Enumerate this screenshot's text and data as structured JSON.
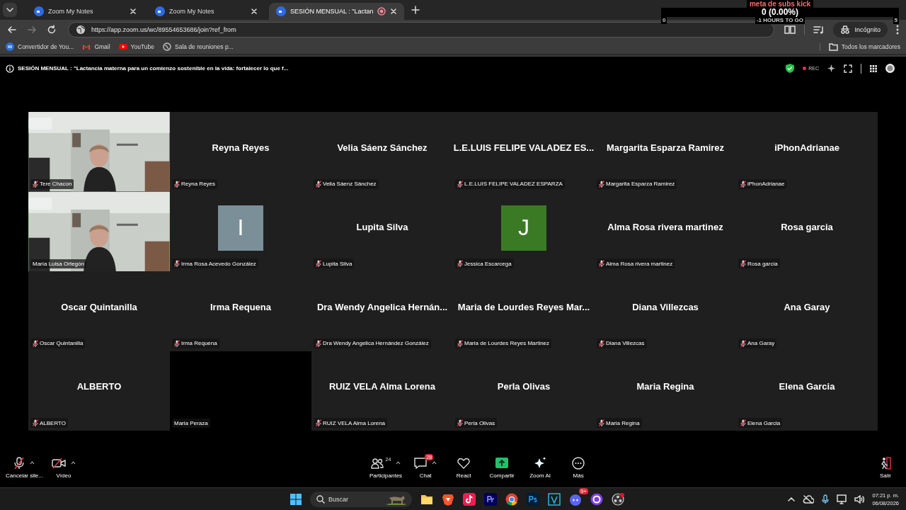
{
  "browser": {
    "tabs": [
      {
        "title": "Zoom My Notes",
        "selected": false
      },
      {
        "title": "Zoom My Notes",
        "selected": false
      },
      {
        "title": "SESIÓN MENSUAL : \"Lactan",
        "selected": true,
        "recording": true
      }
    ],
    "url": "https://app.zoom.us/wc/89554653686/join?ref_from",
    "profile": "Incógnito",
    "bookmarks": [
      "Convertidor de You...",
      "Gmail",
      "YouTube",
      "Sala de reuniones p..."
    ],
    "all_bookmarks": "Todos los marcadores"
  },
  "overlay": {
    "title": "meta de subs kick",
    "value": "0 (0.00%)",
    "min": "0",
    "remaining": "-1 HOURS TO GO",
    "max": "5"
  },
  "meeting": {
    "title": "SESIÓN MENSUAL : \"Lactancia materna para un comienzo sostenible en la vida: fortalecer lo que f...",
    "recording": "REC"
  },
  "tiles": [
    {
      "kind": "video",
      "label": "Tere Chacon",
      "muted": true,
      "speaking": false
    },
    {
      "kind": "name",
      "name": "Reyna Reyes",
      "label": "Reyna Reyes",
      "muted": true,
      "speaking": false
    },
    {
      "kind": "name",
      "name": "Velia Sáenz Sánchez",
      "label": "Velia Sáenz Sánchez",
      "muted": true,
      "speaking": false
    },
    {
      "kind": "name",
      "name": "L.E.LUIS FELIPE VALADEZ ES...",
      "label": "L.E.LUIS FELIPE VALADEZ ESPARZA",
      "muted": true,
      "speaking": false
    },
    {
      "kind": "name",
      "name": "Margarita Esparza Ramirez",
      "label": "Margarita Esparza Ramirez",
      "muted": true,
      "speaking": false
    },
    {
      "kind": "name",
      "name": "iPhonAdrianae",
      "label": "iPhonAdrianae",
      "muted": true,
      "speaking": false
    },
    {
      "kind": "video",
      "label": "María Luisa Ortegón",
      "muted": false,
      "speaking": true
    },
    {
      "kind": "avatar",
      "initial": "I",
      "color": "#7b8f99",
      "label": "Irma Rosa Acevedo González",
      "muted": true,
      "speaking": false
    },
    {
      "kind": "name",
      "name": "Lupita Silva",
      "label": "Lupita Silva",
      "muted": true,
      "speaking": false
    },
    {
      "kind": "avatar",
      "initial": "J",
      "color": "#3b7a25",
      "label": "Jessica Escarcega",
      "muted": true,
      "speaking": false
    },
    {
      "kind": "name",
      "name": "Alma Rosa rivera martinez",
      "label": "Alma Rosa rivera martinez",
      "muted": true,
      "speaking": false
    },
    {
      "kind": "name",
      "name": "Rosa garcia",
      "label": "Rosa garcia",
      "muted": true,
      "speaking": false
    },
    {
      "kind": "name",
      "name": "Oscar Quintanilla",
      "label": "Oscar Quintanilla",
      "muted": true,
      "speaking": false
    },
    {
      "kind": "name",
      "name": "Irma Requena",
      "label": "Irma Requena",
      "muted": true,
      "speaking": false
    },
    {
      "kind": "name",
      "name": "Dra Wendy Angelica Hernán...",
      "label": "Dra Wendy Angelica Hernández González",
      "muted": true,
      "speaking": false
    },
    {
      "kind": "name",
      "name": "Maria de Lourdes Reyes Mar...",
      "label": "Maria de Lourdes Reyes Martinez",
      "muted": true,
      "speaking": false
    },
    {
      "kind": "name",
      "name": "Diana Villezcas",
      "label": "Diana Villezcas",
      "muted": true,
      "speaking": false
    },
    {
      "kind": "name",
      "name": "Ana Garay",
      "label": "Ana Garay",
      "muted": true,
      "speaking": false
    },
    {
      "kind": "name",
      "name": "ALBERTO",
      "label": "ALBERTO",
      "muted": true,
      "speaking": false
    },
    {
      "kind": "blank",
      "label": "Maria Peraza",
      "muted": false,
      "speaking": false
    },
    {
      "kind": "name",
      "name": "RUIZ VELA Alma Lorena",
      "label": "RUIZ VELA Alma Lorena",
      "muted": true,
      "speaking": false
    },
    {
      "kind": "name",
      "name": "Perla Olivas",
      "label": "Perla Olivas",
      "muted": true,
      "speaking": false
    },
    {
      "kind": "name",
      "name": "Maria Regina",
      "label": "Maria Regina",
      "muted": true,
      "speaking": false
    },
    {
      "kind": "name",
      "name": "Elena Garcia",
      "label": "Elena Garcia",
      "muted": true,
      "speaking": false
    }
  ],
  "toolbar": {
    "left": [
      {
        "kind": "mic",
        "label": "Cancelar sile...",
        "caret": true
      },
      {
        "kind": "video",
        "label": "Vídeo",
        "caret": true
      }
    ],
    "center": [
      {
        "kind": "participants",
        "label": "Participantes",
        "count": "24",
        "caret": true
      },
      {
        "kind": "chat",
        "label": "Chat",
        "badge": "28",
        "caret": true
      },
      {
        "kind": "react",
        "label": "React",
        "caret": false
      },
      {
        "kind": "share",
        "label": "Compartir",
        "caret": false
      },
      {
        "kind": "ai",
        "label": "Zoom AI",
        "caret": false
      },
      {
        "kind": "more",
        "label": "Más",
        "caret": false
      }
    ],
    "right": [
      {
        "kind": "leave",
        "label": "Salir",
        "caret": false
      }
    ]
  },
  "taskbar": {
    "search": {
      "placeholder": "Buscar"
    },
    "time": "07:21 p. m.",
    "date": "06/08/2026",
    "discord_badge": "9+"
  }
}
